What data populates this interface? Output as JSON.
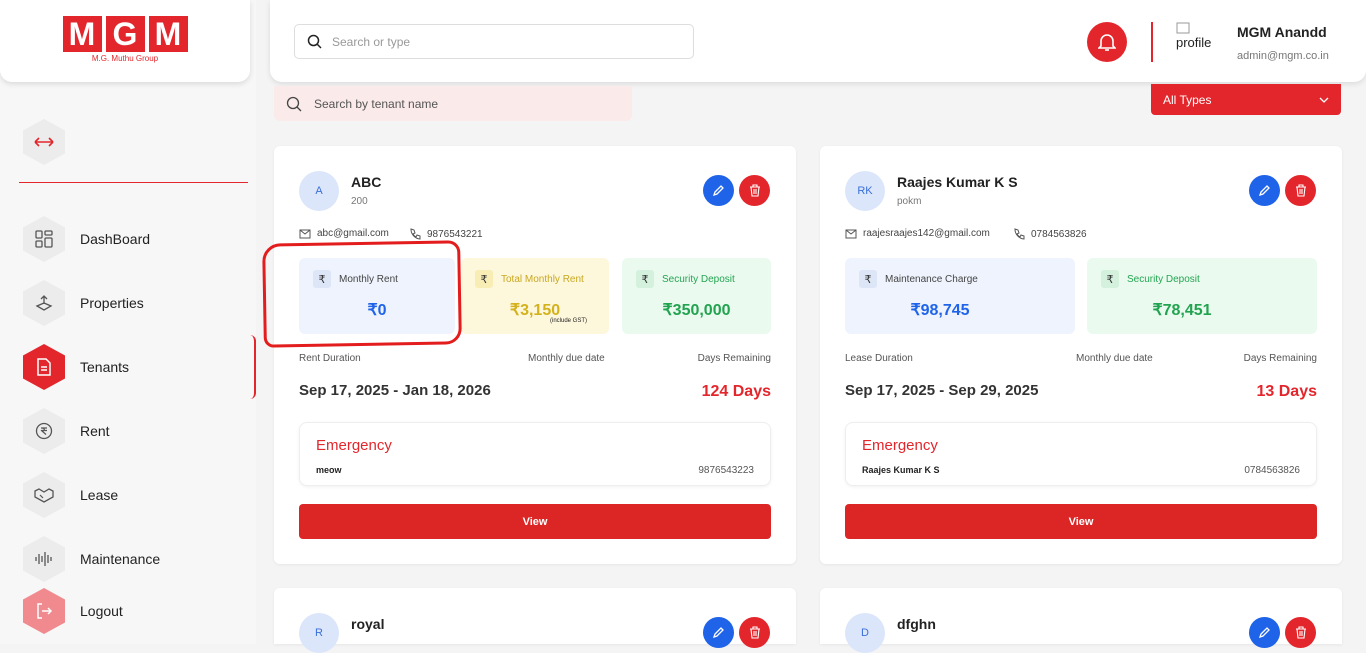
{
  "brand": {
    "letters": [
      "M",
      "G",
      "M"
    ],
    "subtitle": "M.G. Muthu Group"
  },
  "nav": {
    "items": [
      {
        "label": "DashBoard",
        "icon": "grid-icon"
      },
      {
        "label": "Properties",
        "icon": "property-icon"
      },
      {
        "label": "Tenants",
        "icon": "document-icon",
        "active": true
      },
      {
        "label": "Rent",
        "icon": "rupee-circle-icon"
      },
      {
        "label": "Lease",
        "icon": "handshake-icon"
      },
      {
        "label": "Maintenance",
        "icon": "waveform-icon"
      },
      {
        "label": "Logout",
        "icon": "logout-icon"
      }
    ]
  },
  "header": {
    "search_placeholder": "Search or type",
    "profile_alt": "profile",
    "user_name": "MGM Anandd",
    "user_email": "admin@mgm.co.in"
  },
  "filters": {
    "tenant_search_placeholder": "Search by tenant name",
    "type_select": "All Types"
  },
  "colors": {
    "accent": "#e3262c",
    "edit": "#1f63e8",
    "rent_blue": "#eef3fd",
    "gst_yellow": "#fdf7dc",
    "deposit_green": "#eafaef"
  },
  "tenants": [
    {
      "initial": "A",
      "name": "ABC",
      "sub": "200",
      "email": "abc@gmail.com",
      "phone": "9876543221",
      "stats": [
        {
          "label": "Monthly Rent",
          "value": "₹0"
        },
        {
          "label": "Total Monthly Rent",
          "value": "₹3,150",
          "note": "(include GST)"
        },
        {
          "label": "Security Deposit",
          "value": "₹350,000"
        }
      ],
      "duration_label": "Rent Duration",
      "due_label": "Monthly due date",
      "remaining_label": "Days Remaining",
      "dates": "Sep 17, 2025 - Jan 18, 2026",
      "days": "124 Days",
      "emergency_title": "Emergency",
      "emergency_name": "meow",
      "emergency_phone": "9876543223",
      "view_label": "View"
    },
    {
      "initial": "RK",
      "name": "Raajes Kumar K S",
      "sub": "pokm",
      "email": "raajesraajes142@gmail.com",
      "phone": "0784563826",
      "stats": [
        {
          "label": "Maintenance Charge",
          "value": "₹98,745"
        },
        {
          "label": "Security Deposit",
          "value": "₹78,451"
        }
      ],
      "duration_label": "Lease Duration",
      "due_label": "Monthly due date",
      "remaining_label": "Days Remaining",
      "dates": "Sep 17, 2025 - Sep 29, 2025",
      "days": "13 Days",
      "emergency_title": "Emergency",
      "emergency_name": "Raajes Kumar K S",
      "emergency_phone": "0784563826",
      "view_label": "View"
    },
    {
      "initial": "R",
      "name": "royal"
    },
    {
      "initial": "D",
      "name": "dfghn"
    }
  ]
}
